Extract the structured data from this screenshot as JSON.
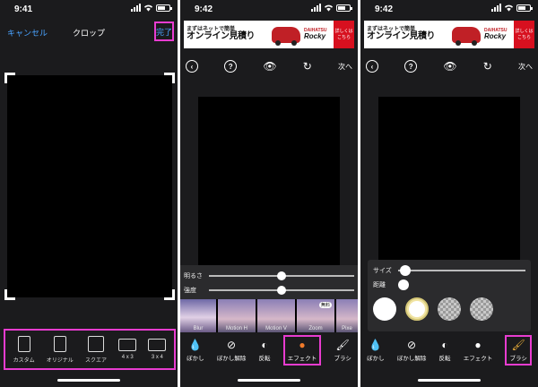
{
  "status": {
    "times": [
      "9:41",
      "9:42",
      "9:42"
    ]
  },
  "screen1": {
    "cancel_label": "キャンセル",
    "title": "クロップ",
    "done_label": "完了",
    "ratios": [
      {
        "label": "カスタム"
      },
      {
        "label": "オリジナル"
      },
      {
        "label": "スクエア"
      },
      {
        "label": "4 x 3"
      },
      {
        "label": "3 x 4"
      }
    ]
  },
  "ad": {
    "small": "まずはネットで簡単",
    "big": "オンライン見積り",
    "brand_top": "DAIHATSU",
    "brand": "Rocky",
    "cta": "詳しくはこちら"
  },
  "toolbar": {
    "back_icon": "chevron-left-icon",
    "help_label": "?",
    "next_label": "次へ"
  },
  "screen2": {
    "sliders": [
      {
        "label": "明るさ",
        "value": 0.5
      },
      {
        "label": "強度",
        "value": 0.5
      }
    ],
    "effects": [
      {
        "label": "Blur"
      },
      {
        "label": "Motion H"
      },
      {
        "label": "Motion V"
      },
      {
        "label": "Zoom",
        "badge": "無料"
      },
      {
        "label": "Pixe"
      }
    ],
    "tabs": [
      {
        "label": "ぼかし"
      },
      {
        "label": "ぼかし解除"
      },
      {
        "label": "反転"
      },
      {
        "label": "エフェクト"
      },
      {
        "label": "ブラシ"
      }
    ]
  },
  "screen3": {
    "size_label": "サイズ",
    "distance_label": "距離",
    "tabs": [
      {
        "label": "ぼかし"
      },
      {
        "label": "ぼかし解除"
      },
      {
        "label": "反転"
      },
      {
        "label": "エフェクト"
      },
      {
        "label": "ブラシ"
      }
    ]
  },
  "colors": {
    "highlight": "#e83cd0",
    "link": "#4aa3ff",
    "background": "#1b1b1d"
  }
}
